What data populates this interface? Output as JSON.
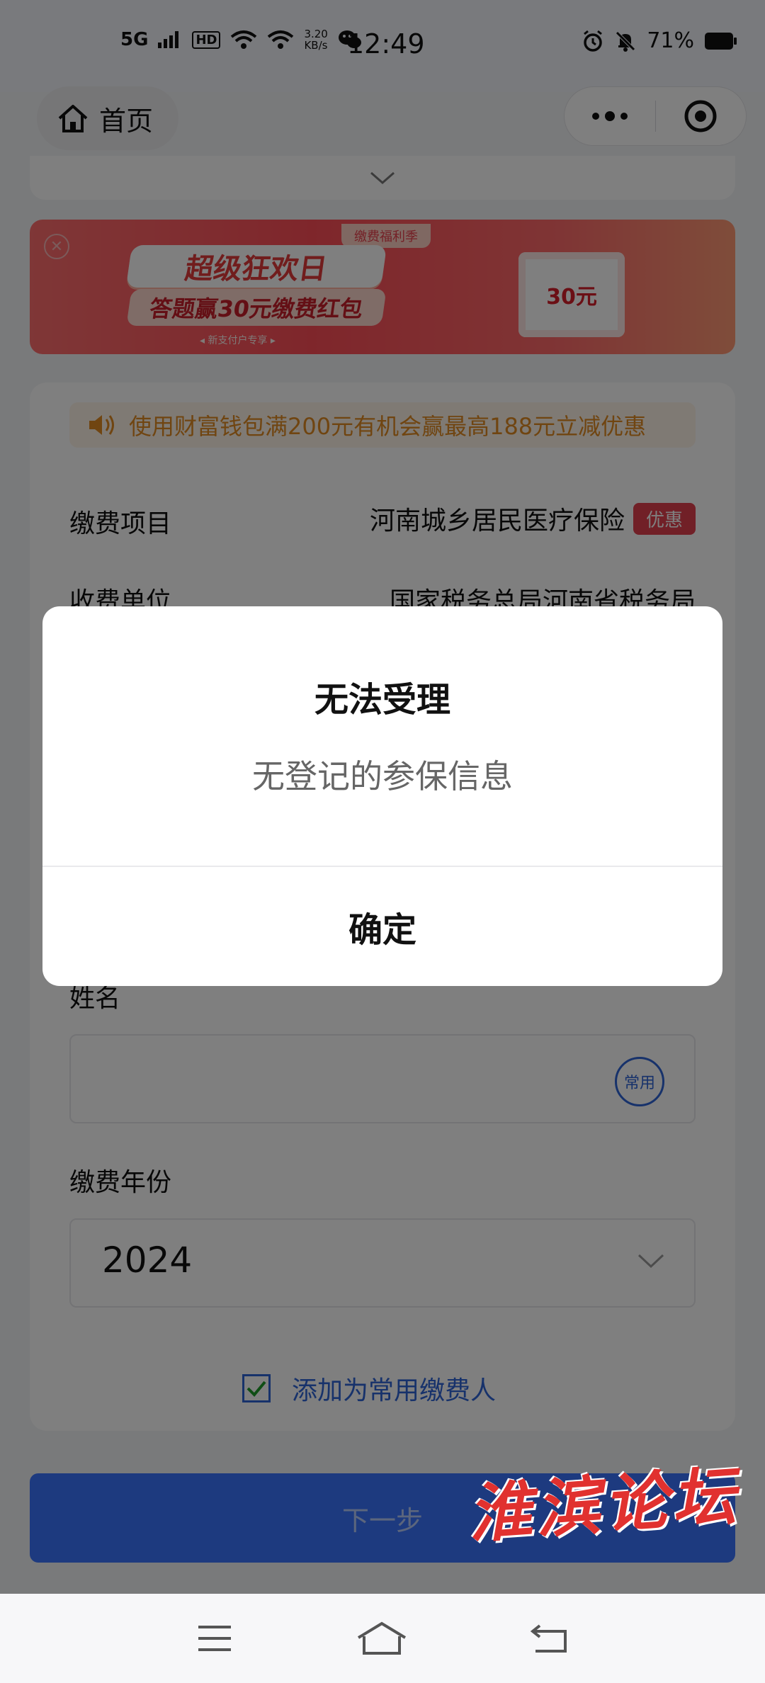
{
  "status_bar": {
    "network": "5G",
    "hd": "HD",
    "speed_value": "3.20",
    "speed_unit": "KB/s",
    "time": "12:49",
    "battery": "71%"
  },
  "nav": {
    "home_label": "首页",
    "icons": [
      "home-icon",
      "more-dots-icon",
      "target-close-icon"
    ]
  },
  "banner": {
    "tag": "缴费福利季",
    "title": "超级狂欢日",
    "subtitle": "答题赢30元缴费红包",
    "footnote": "◂ 新支付户专享 ▸",
    "gift_amount": "30元"
  },
  "notice": {
    "text": "使用财富钱包满200元有机会赢最高188元立减优惠"
  },
  "form": {
    "item_label": "缴费项目",
    "item_value": "河南城乡居民医疗保险",
    "item_badge": "优惠",
    "payee_label": "收费单位",
    "payee_value": "国家税务总局河南省税务局",
    "name_label": "姓名",
    "name_badge": "常用",
    "year_label": "缴费年份",
    "year_value": "2024",
    "add_common_label": "添加为常用缴费人",
    "add_common_checked": true
  },
  "next_button": {
    "label": "下一步"
  },
  "watermark": "淮滨论坛",
  "modal": {
    "title": "无法受理",
    "message": "无登记的参保信息",
    "confirm_label": "确定"
  },
  "colors": {
    "accent_blue": "#3b74ff",
    "badge_red": "#e2404f",
    "notice_orange": "#e08a23",
    "overlay": "rgba(0,0,0,0.5)"
  }
}
